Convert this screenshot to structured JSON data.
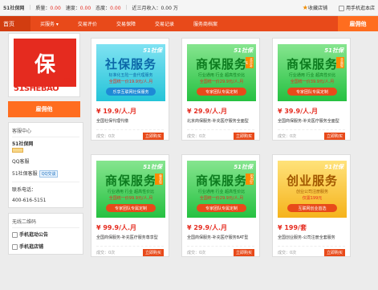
{
  "topbar": {
    "site_name": "51社保网",
    "stat1_label": "质量：",
    "stat1_value": "0.00",
    "stat2_label": "速度：",
    "stat2_value": "0.00",
    "stat3_label": "态度：",
    "stat3_value": "0.00",
    "income": "近三月收入：0.00 万",
    "favorite": "收藏店铺",
    "user_center": "用手机逛本店"
  },
  "nav": {
    "home": "首页",
    "items": [
      "买服务 ▾",
      "交易评价",
      "交易保障",
      "交易记录",
      "服务商档案"
    ],
    "shop_button": "雇佣他"
  },
  "left": {
    "logo_text": "51SHEBAO",
    "logo_com": ".COM",
    "logo_char": "保",
    "hire_button": "雇佣他",
    "service_center": {
      "heading": "客服中心",
      "shop_name": "51社保网",
      "qq_label": "QQ客服",
      "qq_user": "51社保客服",
      "qq_button": "QQ交谈",
      "phone_label": "联系电话：",
      "phone": "400-616-5151"
    },
    "qr_panel": {
      "heading": "无线二维码",
      "item1": "手机逛动公告",
      "item2": "手机逛店铺"
    }
  },
  "cards": [
    {
      "brand": "51社保",
      "title": "社保服务",
      "line1": "标准化五险一金代理服务",
      "line2": "全国统一价19.9元/人.月",
      "line3": "乐享互联网社保服务",
      "price": "¥ 19.9/人.月",
      "desc": "全国社保代理代缴",
      "sales": "成交：0次",
      "buy": "立即购买",
      "style": "c"
    },
    {
      "brand": "51社保",
      "title": "商保服务",
      "tag": "北京补充",
      "line1": "行业通用 行业 超高性价比",
      "line2": "全国统一价29.9元/人.月",
      "line3": "专家团队专属定制",
      "price": "¥ 29.9/人.月",
      "desc": "北京商保服务-补充医疗服务全面型",
      "sales": "成交：0次",
      "buy": "立即购买",
      "style": "g"
    },
    {
      "brand": "51社保",
      "title": "商保服务",
      "tag": "全面型",
      "line1": "行业通用 行业 超高性价比",
      "line2": "全国统一价39.9元/人.月",
      "line3": "专家团队专属定制",
      "price": "¥ 39.9/人.月",
      "desc": "全国商保服务-补充医疗服务全面型",
      "sales": "成交：0次",
      "buy": "立即购买",
      "style": "g"
    },
    {
      "brand": "51社保",
      "title": "商保服务",
      "tag": "尊享型",
      "line1": "行业通用 行业 超高性价比",
      "line2": "全国统一价99.9元/人.月",
      "line3": "专家团队专属定制",
      "price": "¥ 99.9/人.月",
      "desc": "全国商保服务-补充医疗服务尊享型",
      "sales": "成交：0次",
      "buy": "立即购买",
      "style": "g"
    },
    {
      "brand": "51社保",
      "title": "商保服务",
      "tag": "BAT型",
      "line1": "行业通用 行业 超高性价比",
      "line2": "全国统一价29.9元/人.月",
      "line3": "专家团队专属定制",
      "price": "¥ 29.9/人.月",
      "desc": "全国商保服务-补充医疗服务BAT型",
      "sales": "成交：0次",
      "buy": "立即购买",
      "style": "g"
    },
    {
      "brand": "51社保",
      "title": "创业服务",
      "line1": "创业公司注册服务",
      "line2": "仅需199元",
      "line3": "互联网创业首选",
      "price": "¥ 199/套",
      "desc": "全国创业服务-公司注册全套服务",
      "sales": "成交：0次",
      "buy": "立即购买",
      "style": "o"
    }
  ]
}
